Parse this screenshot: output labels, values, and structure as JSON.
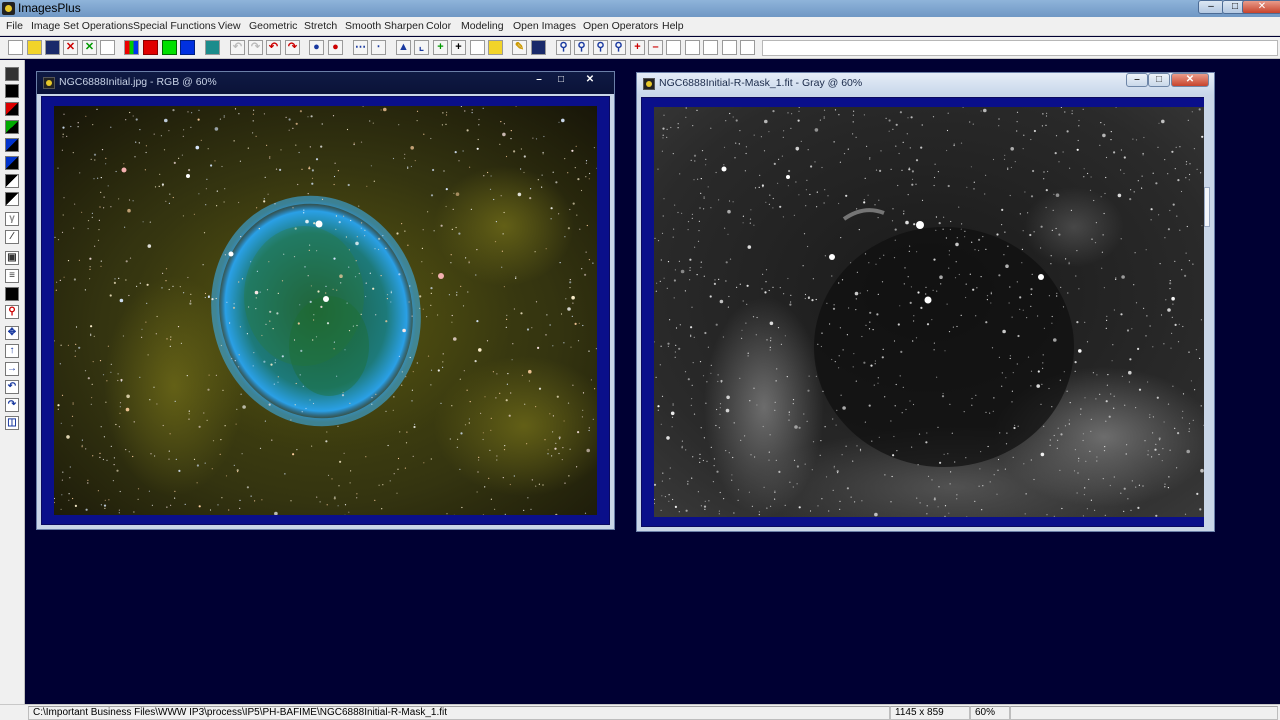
{
  "app": {
    "title": "ImagesPlus"
  },
  "menu": [
    "File",
    "Image Set Operations",
    "Special Functions",
    "View",
    "Geometric",
    "Stretch",
    "Smooth Sharpen",
    "Color",
    "Modeling",
    "Open Images",
    "Open Operators",
    "Help"
  ],
  "windows": [
    {
      "title": "NGC6888Initial.jpg - RGB @ 60%",
      "kind": "color"
    },
    {
      "title": "NGC6888Initial-R-Mask_1.fit - Gray @ 60%",
      "kind": "gray"
    }
  ],
  "status": {
    "path": "C:\\Important Business Files\\WWW IP3\\process\\IP5\\PH-BAFIME\\NGC6888Initial-R-Mask_1.fit",
    "dimensions": "1145 x 859",
    "zoom": "60%"
  },
  "colors": {
    "mdi_background": "#000033",
    "image_frame": "#0a0f8a"
  },
  "icons": {
    "toolbar": [
      "new-file-icon",
      "open-folder-icon",
      "save-icon",
      "close-red-x-icon",
      "close-green-x-icon",
      "copy-icon",
      "rgb-channels-icon",
      "red-channel-icon",
      "green-channel-icon",
      "blue-channel-icon",
      "grid-icon",
      "undo-icon",
      "redo-icon",
      "undo-red-icon",
      "redo-red-icon",
      "star-mask-icon",
      "star-mask-red-icon",
      "line-profile-icon",
      "star-profile-icon",
      "levels-icon",
      "histogram-icon",
      "crosshair-plus-icon",
      "crosshair-icon",
      "calculator-icon",
      "paint-icon",
      "pencil-icon",
      "grid-table-icon",
      "zoom-in-icon",
      "zoom-out-icon",
      "zoom-fit-icon",
      "zoom-actual-icon",
      "add-icon",
      "subtract-icon",
      "square-icon",
      "square2-icon",
      "square3-icon",
      "square4-icon",
      "square5-icon"
    ],
    "left": [
      "save-small-icon",
      "black-square-icon",
      "red-black-icon",
      "green-black-icon",
      "blue-black-icon",
      "blue-black2-icon",
      "black-white-icon",
      "black-white2-icon",
      "gamma-icon",
      "pencil-line-icon",
      "target-icon",
      "list-icon",
      "black-bar-icon",
      "magnify-red-icon",
      "move-icon",
      "arrow-up-icon",
      "arrow-right-icon",
      "rotate-left-icon",
      "rotate-right-icon",
      "frame-icon"
    ]
  }
}
